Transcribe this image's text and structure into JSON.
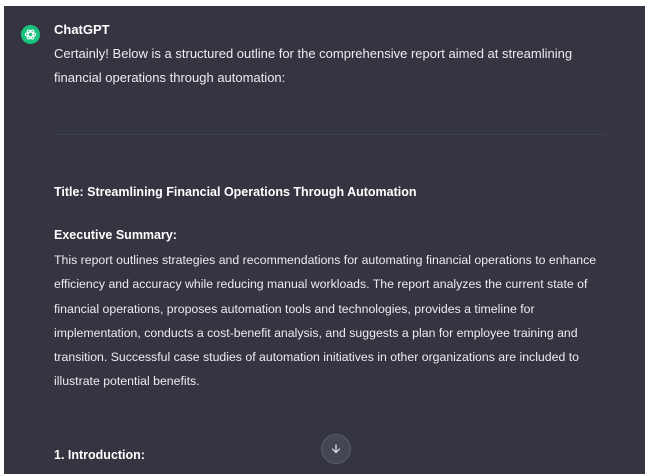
{
  "message": {
    "author": "ChatGPT",
    "avatar_icon": "openai-logo-icon",
    "avatar_color": "#19c37d",
    "intro": "Certainly! Below is a structured outline for the comprehensive report aimed at streamlining financial operations through automation:"
  },
  "report": {
    "title": "Title: Streamlining Financial Operations Through Automation",
    "executive_summary_heading": "Executive Summary:",
    "executive_summary_text": "This report outlines strategies and recommendations for automating financial operations to enhance efficiency and accuracy while reducing manual workloads. The report analyzes the current state of financial operations, proposes automation tools and technologies, provides a timeline for implementation, conducts a cost-benefit analysis, and suggests a plan for employee training and transition. Successful case studies of automation initiatives in other organizations are included to illustrate potential benefits.",
    "section_1_heading": "1. Introduction:"
  },
  "controls": {
    "scroll_down_icon": "arrow-down-icon"
  },
  "colors": {
    "background": "#343541",
    "text": "#ececf1",
    "accent": "#19c37d"
  }
}
